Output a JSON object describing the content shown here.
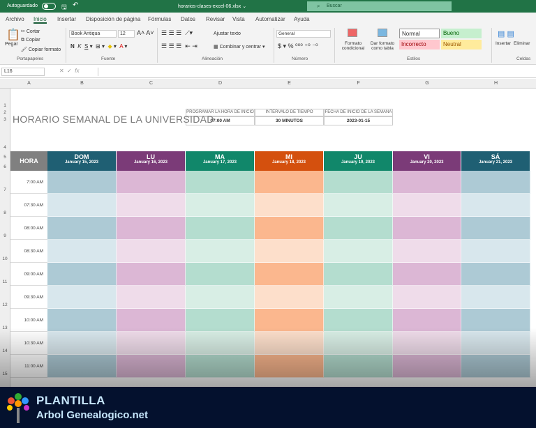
{
  "titlebar": {
    "autosave": "Autoguardado",
    "filename": "horarios-clases-excel-06.xlsx ⌄",
    "search": "Buscar"
  },
  "tabs": [
    "Archivo",
    "Inicio",
    "Insertar",
    "Disposición de página",
    "Fórmulas",
    "Datos",
    "Revisar",
    "Vista",
    "Automatizar",
    "Ayuda"
  ],
  "ribbon": {
    "paste": "Pegar",
    "cut": "Cortar",
    "copy": "Copiar",
    "format_painter": "Copiar formato",
    "font": "Book Antiqua",
    "size": "12",
    "wrap": "Ajustar texto",
    "merge": "Combinar y centrar",
    "number_format": "General",
    "cond_format": "Formato condicional",
    "table_format": "Dar formato como tabla",
    "styles": {
      "normal": "Normal",
      "good": "Bueno",
      "bad": "Incorrecto",
      "neutral": "Neutral"
    },
    "insert": "Insertar",
    "delete": "Eliminar",
    "groups": [
      "Portapapeles",
      "Fuente",
      "Alineación",
      "Número",
      "Estilos",
      "Celdas"
    ]
  },
  "namebox": "L16",
  "columns": [
    "A",
    "B",
    "C",
    "D",
    "E",
    "F",
    "G",
    "H"
  ],
  "rows": [
    "1",
    "2",
    "3",
    "4",
    "5",
    "6",
    "7",
    "8",
    "9",
    "10",
    "11",
    "12",
    "13",
    "14",
    "15"
  ],
  "sheet": {
    "title": "HORARIO SEMANAL DE LA UNIVERSIDAD",
    "info": [
      {
        "label": "PROGRAMAR LA HORA DE INICIO",
        "value": "07:00 AM"
      },
      {
        "label": "INTERVALO DE TIEMPO",
        "value": "30 MINUTOS"
      },
      {
        "label": "FECHA DE INICIO DE LA SEMANA",
        "value": "2023-01-15"
      }
    ],
    "hora": "HORA",
    "days": [
      {
        "name": "DOM",
        "date": "January 15, 2023",
        "color": "#1f5f73",
        "dark": "#adcad5",
        "light": "#d8e7ed"
      },
      {
        "name": "LU",
        "date": "January 16, 2023",
        "color": "#7b3b78",
        "dark": "#dcb7d5",
        "light": "#efdcea"
      },
      {
        "name": "MA",
        "date": "January 17, 2023",
        "color": "#11876a",
        "dark": "#b4ddcf",
        "light": "#d8eee5"
      },
      {
        "name": "MI",
        "date": "January 18, 2023",
        "color": "#d4500e",
        "dark": "#fbb78e",
        "light": "#fddfcb"
      },
      {
        "name": "JU",
        "date": "January 19, 2023",
        "color": "#11876a",
        "dark": "#b4ddcf",
        "light": "#d8eee5"
      },
      {
        "name": "VI",
        "date": "January 20, 2023",
        "color": "#7b3b78",
        "dark": "#dcb7d5",
        "light": "#efdcea"
      },
      {
        "name": "SÁ",
        "date": "January 21, 2023",
        "color": "#1f5f73",
        "dark": "#adcad5",
        "light": "#d8e7ed"
      }
    ],
    "times": [
      "7:00 AM",
      "07:30 AM",
      "08:00 AM",
      "08:30 AM",
      "09:00 AM",
      "09:30 AM",
      "10:00 AM",
      "10:30 AM",
      "11:00 AM"
    ]
  },
  "banner": {
    "line1": "PLANTILLA",
    "line2": "Arbol Genealogico.net"
  }
}
